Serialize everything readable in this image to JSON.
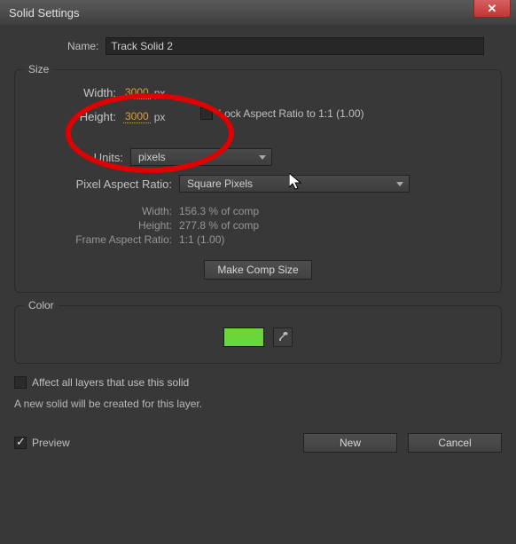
{
  "window": {
    "title": "Solid Settings"
  },
  "name": {
    "label": "Name:",
    "value": "Track Solid 2"
  },
  "size": {
    "title": "Size",
    "width_label": "Width:",
    "width_value": "3000",
    "height_label": "Height:",
    "height_value": "3000",
    "px_suffix": "px",
    "lock_label": "Lock Aspect Ratio to 1:1 (1.00)",
    "units_label": "Units:",
    "units_value": "pixels",
    "par_label": "Pixel Aspect Ratio:",
    "par_value": "Square Pixels",
    "info_width_label": "Width:",
    "info_width_value": "156.3 % of comp",
    "info_height_label": "Height:",
    "info_height_value": "277.8 % of comp",
    "info_frame_label": "Frame Aspect Ratio:",
    "info_frame_value": "1:1 (1.00)",
    "make_comp_btn": "Make Comp Size"
  },
  "color": {
    "title": "Color",
    "swatch_hex": "#6ad63a"
  },
  "affect_label": "Affect all layers that use this solid",
  "note_text": "A new solid will be created for this layer.",
  "preview_label": "Preview",
  "buttons": {
    "new": "New",
    "cancel": "Cancel"
  }
}
